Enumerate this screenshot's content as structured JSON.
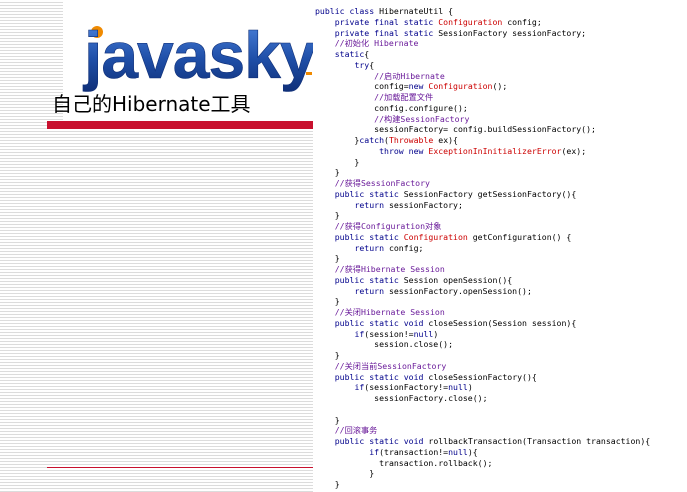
{
  "slide": {
    "logo_text": "javasky",
    "title": "自己的Hibernate工具"
  },
  "code": {
    "lines": [
      [
        [
          "k",
          "public class "
        ],
        [
          "p",
          "HibernateUtil {"
        ]
      ],
      [
        [
          "p",
          "    "
        ],
        [
          "k",
          "private final static "
        ],
        [
          "t",
          "Configuration"
        ],
        [
          "p",
          " config;"
        ]
      ],
      [
        [
          "p",
          "    "
        ],
        [
          "k",
          "private final static "
        ],
        [
          "p",
          "SessionFactory sessionFactory;"
        ]
      ],
      [
        [
          "p",
          "    "
        ],
        [
          "c",
          "//初始化 Hibernate"
        ]
      ],
      [
        [
          "p",
          "    "
        ],
        [
          "k",
          "static"
        ],
        [
          "p",
          "{"
        ]
      ],
      [
        [
          "p",
          "        "
        ],
        [
          "k",
          "try"
        ],
        [
          "p",
          "{"
        ]
      ],
      [
        [
          "p",
          "            "
        ],
        [
          "c",
          "//启动Hibernate"
        ]
      ],
      [
        [
          "p",
          "            config="
        ],
        [
          "k",
          "new "
        ],
        [
          "t",
          "Configuration"
        ],
        [
          "p",
          "();"
        ]
      ],
      [
        [
          "p",
          "            "
        ],
        [
          "c",
          "//加载配置文件"
        ]
      ],
      [
        [
          "p",
          "            config.configure();"
        ]
      ],
      [
        [
          "p",
          "            "
        ],
        [
          "c",
          "//构建SessionFactory"
        ]
      ],
      [
        [
          "p",
          "            sessionFactory= config.buildSessionFactory();"
        ]
      ],
      [
        [
          "p",
          "        }"
        ],
        [
          "k",
          "catch"
        ],
        [
          "p",
          "("
        ],
        [
          "t",
          "Throwable"
        ],
        [
          "p",
          " ex){"
        ]
      ],
      [
        [
          "p",
          "             "
        ],
        [
          "k",
          "throw new "
        ],
        [
          "t",
          "ExceptionInInitializerError"
        ],
        [
          "p",
          "(ex);"
        ]
      ],
      [
        [
          "p",
          "        }"
        ]
      ],
      [
        [
          "p",
          "    }"
        ]
      ],
      [
        [
          "p",
          "    "
        ],
        [
          "c",
          "//获得SessionFactory"
        ]
      ],
      [
        [
          "p",
          "    "
        ],
        [
          "k",
          "public static "
        ],
        [
          "p",
          "SessionFactory getSessionFactory(){"
        ]
      ],
      [
        [
          "p",
          "        "
        ],
        [
          "k",
          "return "
        ],
        [
          "p",
          "sessionFactory;"
        ]
      ],
      [
        [
          "p",
          "    }"
        ]
      ],
      [
        [
          "p",
          "    "
        ],
        [
          "c",
          "//获得Configuration对象"
        ]
      ],
      [
        [
          "p",
          "    "
        ],
        [
          "k",
          "public static "
        ],
        [
          "t",
          "Configuration"
        ],
        [
          "p",
          " getConfiguration() {"
        ]
      ],
      [
        [
          "p",
          "        "
        ],
        [
          "k",
          "return "
        ],
        [
          "p",
          "config;"
        ]
      ],
      [
        [
          "p",
          "    }"
        ]
      ],
      [
        [
          "p",
          "    "
        ],
        [
          "c",
          "//获得Hibernate Session"
        ]
      ],
      [
        [
          "p",
          "    "
        ],
        [
          "k",
          "public static "
        ],
        [
          "p",
          "Session openSession(){"
        ]
      ],
      [
        [
          "p",
          "        "
        ],
        [
          "k",
          "return "
        ],
        [
          "p",
          "sessionFactory.openSession();"
        ]
      ],
      [
        [
          "p",
          "    }"
        ]
      ],
      [
        [
          "p",
          "    "
        ],
        [
          "c",
          "//关闭Hibernate Session"
        ]
      ],
      [
        [
          "p",
          "    "
        ],
        [
          "k",
          "public static void "
        ],
        [
          "p",
          "closeSession(Session session){"
        ]
      ],
      [
        [
          "p",
          "        "
        ],
        [
          "k",
          "if"
        ],
        [
          "p",
          "(session!="
        ],
        [
          "k",
          "null"
        ],
        [
          "p",
          ")"
        ]
      ],
      [
        [
          "p",
          "            session.close();"
        ]
      ],
      [
        [
          "p",
          "    }"
        ]
      ],
      [
        [
          "p",
          "    "
        ],
        [
          "c",
          "//关闭当前SessionFactory"
        ]
      ],
      [
        [
          "p",
          "    "
        ],
        [
          "k",
          "public static void "
        ],
        [
          "p",
          "closeSessionFactory(){"
        ]
      ],
      [
        [
          "p",
          "        "
        ],
        [
          "k",
          "if"
        ],
        [
          "p",
          "(sessionFactory!="
        ],
        [
          "k",
          "null"
        ],
        [
          "p",
          ")"
        ]
      ],
      [
        [
          "p",
          "            sessionFactory.close();"
        ]
      ],
      [
        [
          "p",
          ""
        ]
      ],
      [
        [
          "p",
          "    }"
        ]
      ],
      [
        [
          "p",
          "    "
        ],
        [
          "c",
          "//回滚事务"
        ]
      ],
      [
        [
          "p",
          "    "
        ],
        [
          "k",
          "public static void "
        ],
        [
          "p",
          "rollbackTransaction(Transaction transaction){"
        ]
      ],
      [
        [
          "p",
          "           "
        ],
        [
          "k",
          "if"
        ],
        [
          "p",
          "(transaction!="
        ],
        [
          "k",
          "null"
        ],
        [
          "p",
          "){"
        ]
      ],
      [
        [
          "p",
          "             transaction.rollback();"
        ]
      ],
      [
        [
          "p",
          "           }"
        ]
      ],
      [
        [
          "p",
          "    }"
        ]
      ]
    ]
  },
  "colors": {
    "keyword": "#00008b",
    "type": "#cc0000",
    "comment": "#6a1b9a",
    "accent_bar": "#c8102e",
    "logo_blue": "#1f4fa8",
    "logo_orange": "#f08a00"
  }
}
